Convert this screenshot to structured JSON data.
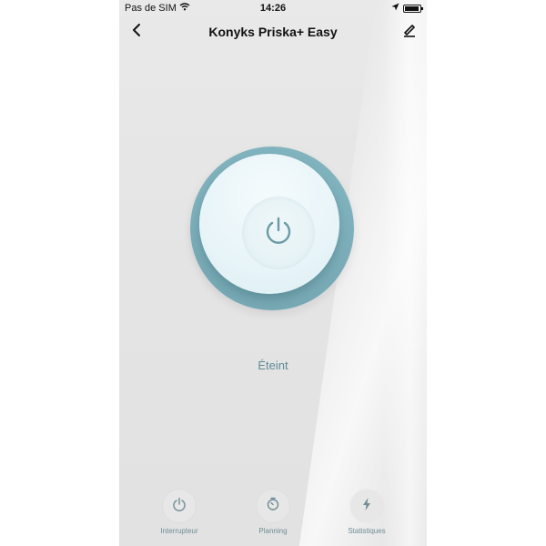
{
  "statusbar": {
    "carrier": "Pas de SIM",
    "time": "14:26",
    "wifi_icon": "wifi-icon",
    "location_icon": "location-arrow-icon",
    "battery_icon": "battery-icon"
  },
  "navbar": {
    "title": "Konyks Priska+ Easy",
    "back_icon": "chevron-left-icon",
    "edit_icon": "pencil-icon"
  },
  "power": {
    "icon": "power-icon",
    "state": "Éteint"
  },
  "tabs": [
    {
      "label": "Interrupteur",
      "icon": "power-icon"
    },
    {
      "label": "Planning",
      "icon": "timer-icon"
    },
    {
      "label": "Statistiques",
      "icon": "lightning-icon"
    }
  ],
  "colors": {
    "accent": "#7fb2bd",
    "state_text": "#5f8a96",
    "background": "#e6e6e6"
  }
}
